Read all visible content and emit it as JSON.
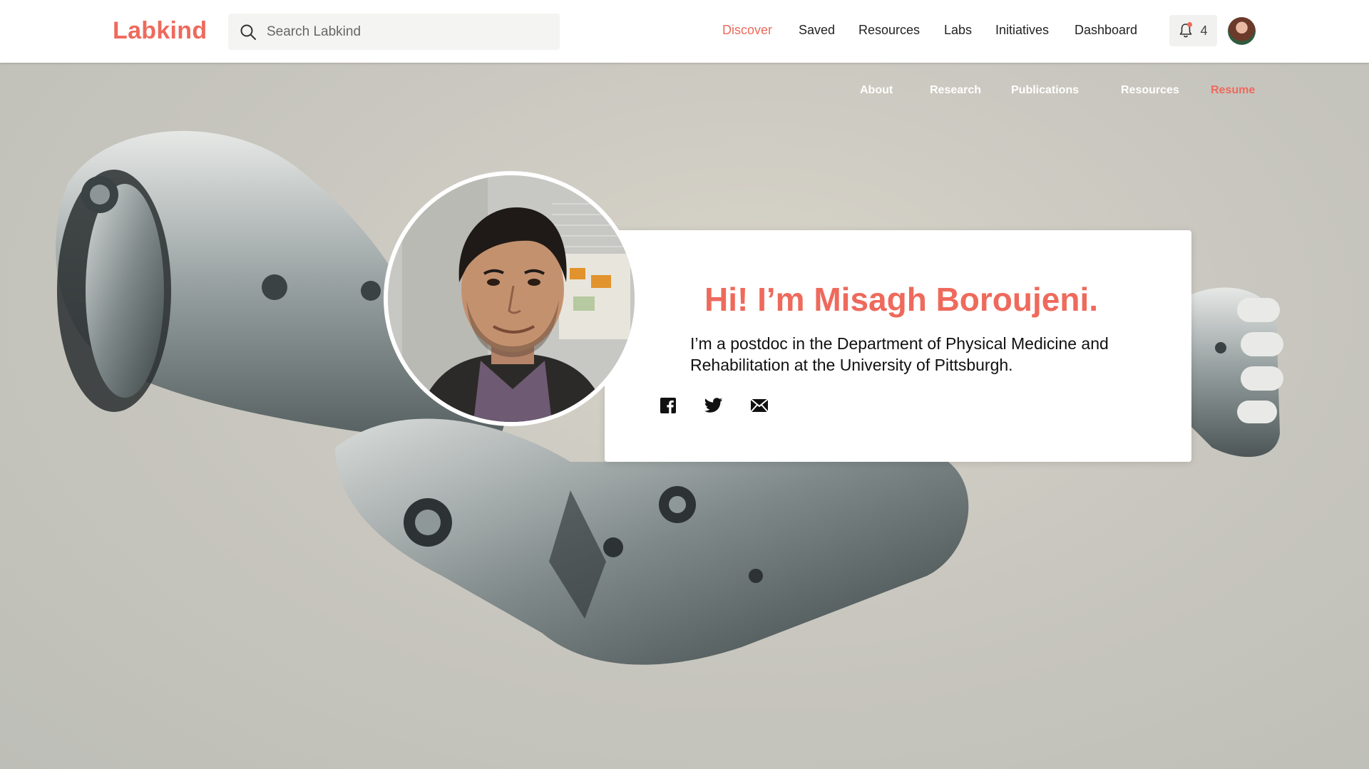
{
  "topbar": {
    "logo": "Labkind",
    "search_placeholder": "Search Labkind",
    "nav": [
      "Discover",
      "Saved",
      "Resources",
      "Labs",
      "Initiatives",
      "Dashboard"
    ],
    "active_nav": "Discover",
    "notification_count": "4"
  },
  "subnav": {
    "items": [
      "About",
      "Research",
      "Publications",
      "Resources",
      "Resume"
    ],
    "active": "Resume"
  },
  "profile": {
    "greeting": "Hi! I’m Misagh Boroujeni.",
    "bio": "I’m a postdoc in the Department of Physical Medicine and Rehabilitation at the University of Pittsburgh.",
    "social_icons": [
      "facebook-icon",
      "twitter-icon",
      "email-icon"
    ]
  },
  "colors": {
    "accent": "#ee6a5c",
    "nav_bg": "#ffffff",
    "text": "#222222"
  }
}
